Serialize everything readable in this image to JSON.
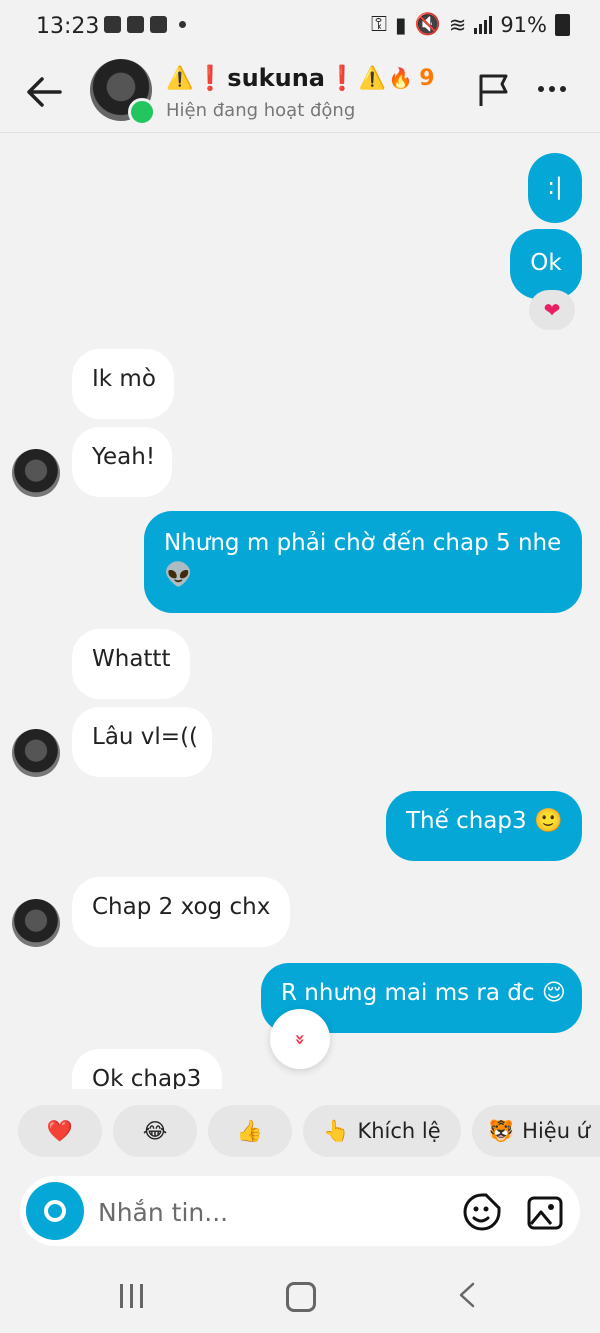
{
  "status_bar": {
    "time": "13:23",
    "battery": "91%"
  },
  "header": {
    "name": "sukuna",
    "warn_symbol": "⚠️",
    "excl_symbol": "❗",
    "streak_icon": "🔥",
    "streak": "9",
    "status": "Hiện đang hoạt động"
  },
  "messages": [
    {
      "text": ":|",
      "dir": "out"
    },
    {
      "text": "Ok",
      "dir": "out",
      "reaction": "❤"
    },
    {
      "text": "Ik mò",
      "dir": "in"
    },
    {
      "text": "Yeah!",
      "dir": "in"
    },
    {
      "text_line1": "Nhưng m phải chờ đến chap 5 nhe",
      "text_line2": "👽",
      "dir": "out"
    },
    {
      "text": "Whattt",
      "dir": "in"
    },
    {
      "text": "Lâu vl=((",
      "dir": "in"
    },
    {
      "text": "Thế chap3 🙂",
      "dir": "out"
    },
    {
      "text": "Chap 2 xog chx",
      "dir": "in"
    },
    {
      "text": "R nhưng mai ms ra đc 😌",
      "dir": "out"
    },
    {
      "text": "Ok chap3",
      "dir": "in"
    }
  ],
  "scroll_down_glyph": "»",
  "quick_reactions": [
    {
      "emoji": "❤️",
      "label": ""
    },
    {
      "emoji": "😂",
      "label": ""
    },
    {
      "emoji": "👍",
      "label": ""
    },
    {
      "emoji": "👆",
      "label": "Khích lệ"
    },
    {
      "emoji": "🐯",
      "label": "Hiệu ứ"
    }
  ],
  "composer": {
    "placeholder": "Nhắn tin..."
  },
  "colors": {
    "outgoing": "#05a7d6",
    "incoming": "#ffffff",
    "online": "#22c55e"
  }
}
